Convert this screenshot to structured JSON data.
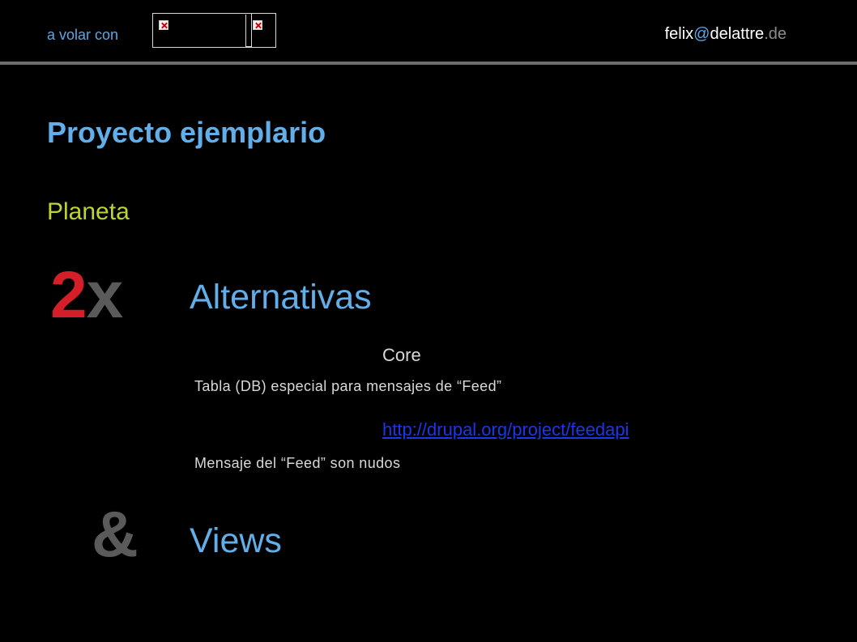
{
  "header": {
    "tagline": "a volar con",
    "email": {
      "user": "felix",
      "at": "@",
      "domain": "delattre",
      "tld": ".de"
    }
  },
  "slide": {
    "title": "Proyecto ejemplario",
    "subtitle": "Planeta",
    "two": "2",
    "x": "x",
    "alternatives_heading": "Alternativas",
    "core_label": "Core",
    "core_description": "Tabla (DB) especial para mensajes de “Feed”",
    "feedapi_link": "http://drupal.org/project/feedapi",
    "feedapi_description": "Mensaje del “Feed” son nudos",
    "ampersand": "&",
    "views_heading": "Views"
  },
  "colors": {
    "background": "#000000",
    "accent_blue": "#62aee9",
    "accent_green": "#bfd331",
    "accent_red": "#d51f28",
    "link_blue": "#1c36e9",
    "muted_gray": "#5a5a5a"
  }
}
